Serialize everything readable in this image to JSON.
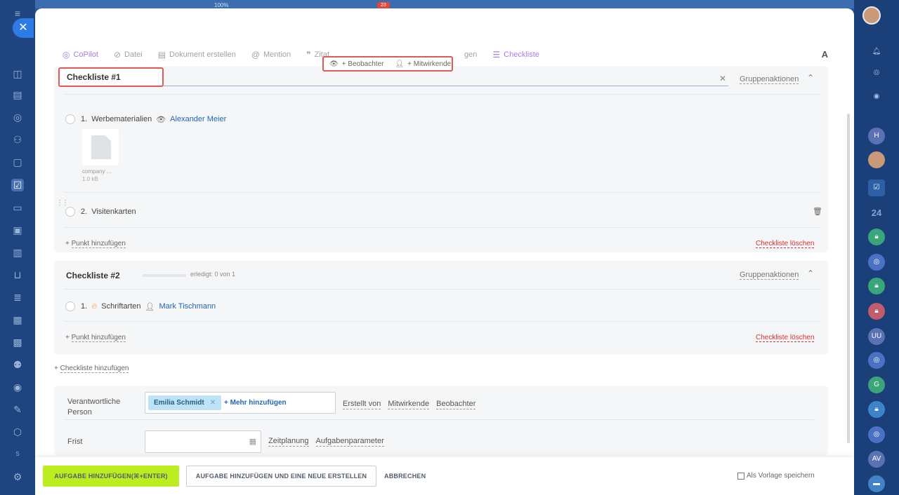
{
  "background": {
    "percent": "100%",
    "badge": "23"
  },
  "left_sidebar": {
    "icons": [
      "menu-icon",
      "home-icon",
      "feed-icon",
      "doc-icon",
      "chat-icon",
      "contacts-icon",
      "file-icon",
      "tasks-icon",
      "card-icon",
      "monitor-icon",
      "chart-icon",
      "cart-icon",
      "filter-icon",
      "news-icon",
      "calendar-icon",
      "robot-icon",
      "target-icon",
      "edit-icon",
      "box-icon"
    ],
    "bottom_label": "S"
  },
  "right_sidebar": {
    "items": [
      {
        "name": "bell-icon",
        "text": ""
      },
      {
        "name": "copilot-icon",
        "text": ""
      },
      {
        "name": "chat-icon",
        "text": ""
      },
      {
        "name": "avatar-h",
        "text": "H"
      },
      {
        "name": "avatar-photo",
        "text": ""
      },
      {
        "name": "tasks-icon",
        "text": ""
      },
      {
        "name": "calendar-24",
        "text": "24"
      },
      {
        "name": "lock-icon",
        "text": ""
      },
      {
        "name": "copilot-icon-2",
        "text": ""
      },
      {
        "name": "lock-icon-2",
        "text": ""
      },
      {
        "name": "lock-icon-3",
        "text": ""
      },
      {
        "name": "avatar-uu",
        "text": "UU"
      },
      {
        "name": "copilot-icon-3",
        "text": ""
      },
      {
        "name": "avatar-g",
        "text": "G"
      },
      {
        "name": "lock-icon-4",
        "text": ""
      },
      {
        "name": "copilot-icon-4",
        "text": ""
      },
      {
        "name": "avatar-av",
        "text": "AV"
      },
      {
        "name": "message-icon",
        "text": ""
      }
    ]
  },
  "toolbar": {
    "copilot": "CoPilot",
    "file": "Datei",
    "create_doc": "Dokument erstellen",
    "mention": "Mention",
    "quote": "Zitat",
    "hidden": "gen",
    "checklist": "Checkliste",
    "font": "A"
  },
  "popup": {
    "observer": "+ Beobachter",
    "participants": "+ Mitwirkende"
  },
  "checklist1": {
    "title": "Checkliste #1",
    "group_actions": "Gruppenaktionen",
    "items": [
      {
        "number": "1.",
        "text": "Werbematerialien",
        "person": "Alexander Meier"
      },
      {
        "number": "2.",
        "text": "Visitenkarten"
      }
    ],
    "file": {
      "name": "company ...",
      "size": "1.0 kB"
    },
    "add_point": "Punkt hinzufügen",
    "delete": "Checkliste löschen"
  },
  "checklist2": {
    "title": "Checkliste #2",
    "progress": "erledigt: 0 von 1",
    "progress_value": 0,
    "group_actions": "Gruppenaktionen",
    "items": [
      {
        "number": "1.",
        "text": "Schriftarten",
        "person": "Mark Tischmann"
      }
    ],
    "add_point": "Punkt hinzufügen",
    "delete": "Checkliste löschen"
  },
  "add_checklist": "Checkliste hinzufügen",
  "params": {
    "responsible_label": "Verantwortliche Person",
    "responsible_chip": "Emilia Schmidt",
    "add_more": "+ Mehr hinzufügen",
    "role_links": [
      "Erstellt von",
      "Mitwirkende",
      "Beobachter"
    ],
    "deadline_label": "Frist",
    "deadline_links": [
      "Zeitplanung",
      "Aufgabenparameter"
    ]
  },
  "footer": {
    "primary": "AUFGABE HINZUFÜGEN(⌘+ENTER)",
    "secondary": "AUFGABE HINZUFÜGEN UND EINE NEUE ERSTELLEN",
    "cancel": "ABBRECHEN",
    "save_template": "Als Vorlage speichern"
  }
}
